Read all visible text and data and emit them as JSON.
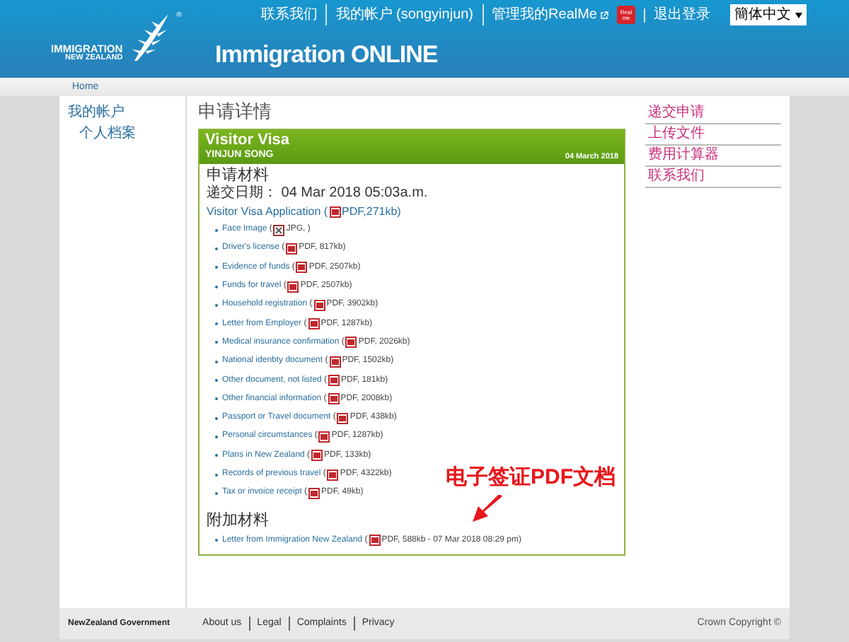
{
  "header": {
    "logo_top": "IMMIGRATION",
    "logo_bottom": "NEW ZEALAND",
    "registered": "®",
    "site_title": "Immigration ONLINE",
    "top_links": [
      "联系我们",
      "我的帐户 (songyinjun)",
      "管理我的RealMe"
    ],
    "realme_logo": "Real me",
    "logout": "退出登录",
    "language": "簡体中文"
  },
  "breadcrumb": [
    "Home"
  ],
  "sidebar": {
    "heading": "我的帐户",
    "items": [
      "个人档案"
    ]
  },
  "page_title": "申请详情",
  "application": {
    "type": "Visitor Visa",
    "applicant": "YINJUN SONG",
    "date": "04 March 2018"
  },
  "materials": {
    "heading": "申请材料",
    "submitted": "递交日期： 04 Mar 2018  05:03a.m.",
    "main_document": {
      "title": "Visitor Visa Application",
      "paren": "(",
      "detail": "PDF,271kb)"
    },
    "documents": [
      {
        "title": "Face Image",
        "paren": "(",
        "kind": "image",
        "detail": "JPG, )"
      },
      {
        "title": "Driver's license",
        "paren": "(",
        "kind": "pdf",
        "detail": "PDF, 817kb)"
      },
      {
        "title": "Evidence of funds",
        "paren": "(",
        "kind": "pdf",
        "detail": "PDF, 2507kb)"
      },
      {
        "title": "Funds for travel",
        "paren": "(",
        "kind": "pdf",
        "detail": "PDF, 2507kb)"
      },
      {
        "title": "Household registration",
        "paren": "(",
        "kind": "pdf",
        "detail": "PDF, 3902kb)"
      },
      {
        "title": "Letter from Employer",
        "paren": "(",
        "kind": "pdf",
        "detail": "PDF, 1287kb)"
      },
      {
        "title": "Medical insurance confirmation",
        "paren": "(",
        "kind": "pdf",
        "detail": "PDF, 2026kb)"
      },
      {
        "title": "National idenbty document",
        "paren": "(",
        "kind": "pdf",
        "detail": "PDF, 1502kb)"
      },
      {
        "title": "Other document, not listed",
        "paren": "(",
        "kind": "pdf",
        "detail": "PDF, 181kb)"
      },
      {
        "title": "Other financial information",
        "paren": "(",
        "kind": "pdf",
        "detail": "PDF, 2008kb)"
      },
      {
        "title": "Passport or Travel document",
        "paren": "(",
        "kind": "pdf",
        "detail": "PDF, 438kb)"
      },
      {
        "title": "Personal circumstances",
        "paren": "(",
        "kind": "pdf",
        "detail": "PDF, 1287kb)"
      },
      {
        "title": "Plans in New Zealand",
        "paren": "(",
        "kind": "pdf",
        "detail": "PDF, 133kb)"
      },
      {
        "title": "Records of previous travel",
        "paren": "(",
        "kind": "pdf",
        "detail": "PDF, 4322kb)"
      },
      {
        "title": "Tax or invoice receipt",
        "paren": "(",
        "kind": "pdf",
        "detail": "PDF, 49kb)"
      }
    ]
  },
  "additional": {
    "heading": "附加材料",
    "documents": [
      {
        "title": "Letter from Immigration New Zealand",
        "paren": "(",
        "kind": "pdf",
        "detail": "PDF, 588kb - 07 Mar 2018 08:29 pm)"
      }
    ]
  },
  "annotation": {
    "text": "电子签证PDF文档"
  },
  "right_menu": [
    "递交申请",
    "上传文件",
    "费用计算器",
    "联系我们"
  ],
  "footer": {
    "brand": "NewZealand Government",
    "links": [
      "About us",
      "Legal",
      "Complaints",
      "Privacy"
    ],
    "copyright": "Crown Copyright ©"
  }
}
